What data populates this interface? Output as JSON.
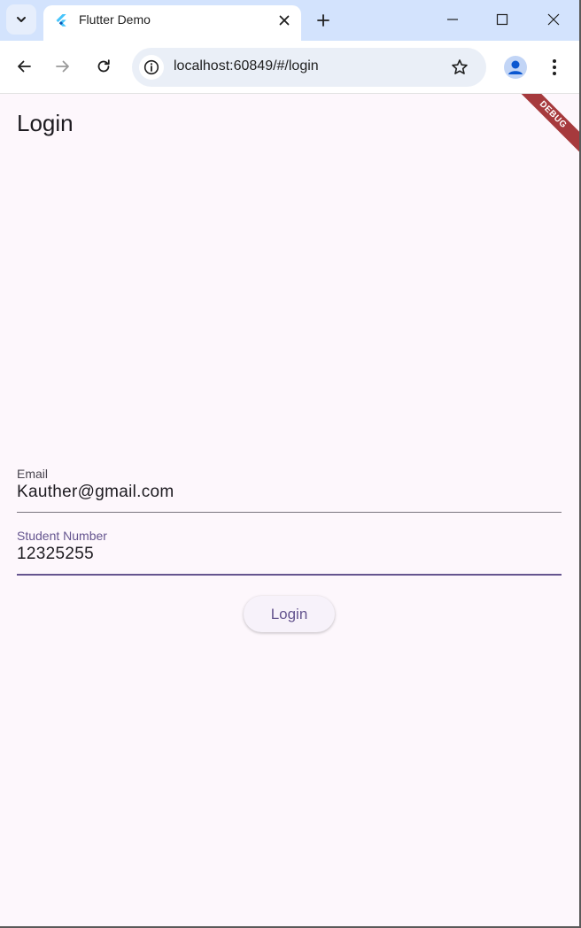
{
  "browser": {
    "tab": {
      "title": "Flutter Demo"
    },
    "address_bar": {
      "url": "localhost:60849/#/login"
    }
  },
  "app": {
    "appbar_title": "Login",
    "debug_banner": "DEBUG",
    "email_field": {
      "label": "Email",
      "value": "Kauther@gmail.com"
    },
    "student_number_field": {
      "label": "Student Number",
      "value": "12325255"
    },
    "login_button_label": "Login"
  },
  "colors": {
    "tabstrip_bg": "#d3e3fd",
    "app_bg": "#fdf7fc",
    "accent": "#65558f",
    "debug_banner": "#a63a3d",
    "flutter_logo_light": "#47c5fb",
    "flutter_logo_dark": "#0d5ab5",
    "profile_icon": "#0b57d0"
  },
  "icons": {
    "tab_list": "chevron-down-icon",
    "favicon": "flutter-logo-icon",
    "tab_close": "close-icon",
    "new_tab": "plus-icon",
    "minimize": "minimize-icon",
    "maximize": "maximize-icon",
    "window_close": "close-icon",
    "back": "arrow-left-icon",
    "forward": "arrow-right-icon",
    "reload": "reload-icon",
    "site_info": "info-icon",
    "bookmark": "star-icon",
    "profile": "person-icon",
    "menu": "more-vert-icon"
  }
}
